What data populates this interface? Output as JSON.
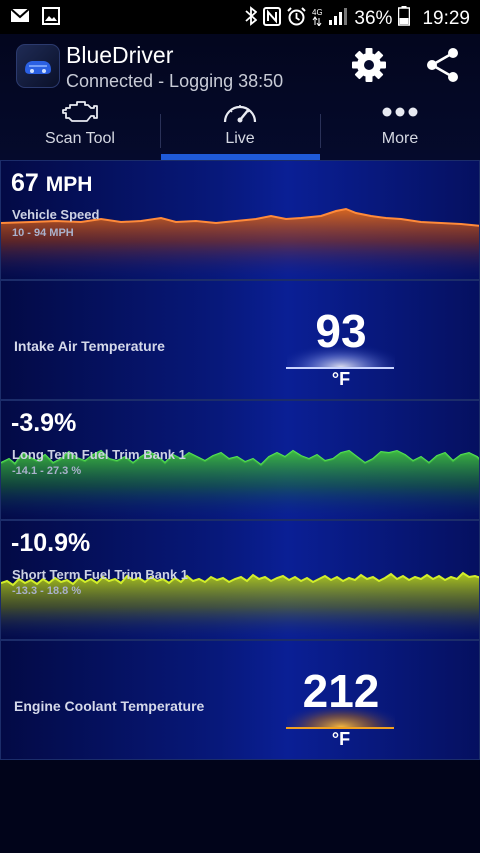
{
  "status_bar": {
    "battery_percent": "36%",
    "time": "19:29",
    "icons": [
      "mail-icon",
      "image-icon",
      "bluetooth-icon",
      "nfc-icon",
      "alarm-icon",
      "4g-icon",
      "signal-icon",
      "battery-icon"
    ]
  },
  "app": {
    "title": "BlueDriver",
    "subtitle": "Connected - Logging 38:50",
    "actions": [
      "settings-gear-icon",
      "share-icon"
    ]
  },
  "tabs": [
    {
      "label": "Scan Tool",
      "icon": "engine-icon",
      "selected": false
    },
    {
      "label": "Live",
      "icon": "speedometer-icon",
      "selected": true
    },
    {
      "label": "More",
      "icon": "more-dots-icon",
      "selected": false
    }
  ],
  "gauges": {
    "speed": {
      "value": "67",
      "unit": "MPH",
      "name": "Vehicle Speed",
      "range": "10 - 94 MPH",
      "color": "#e06a1c"
    },
    "intake": {
      "name": "Intake Air Temperature",
      "value": "93",
      "unit": "°F",
      "glow": "#ffffff"
    },
    "ltft": {
      "value": "-3.9%",
      "name": "Long Term Fuel Trim Bank 1",
      "range": "-14.1 - 27.3 %",
      "color": "#3fc03f"
    },
    "stft": {
      "value": "-10.9%",
      "name": "Short Term Fuel Trim Bank 1",
      "range": "-13.3 - 18.8 %",
      "color": "#b7d21a"
    },
    "coolant": {
      "name": "Engine Coolant Temperature",
      "value": "212",
      "unit": "°F",
      "glow": "#f0a020"
    }
  }
}
